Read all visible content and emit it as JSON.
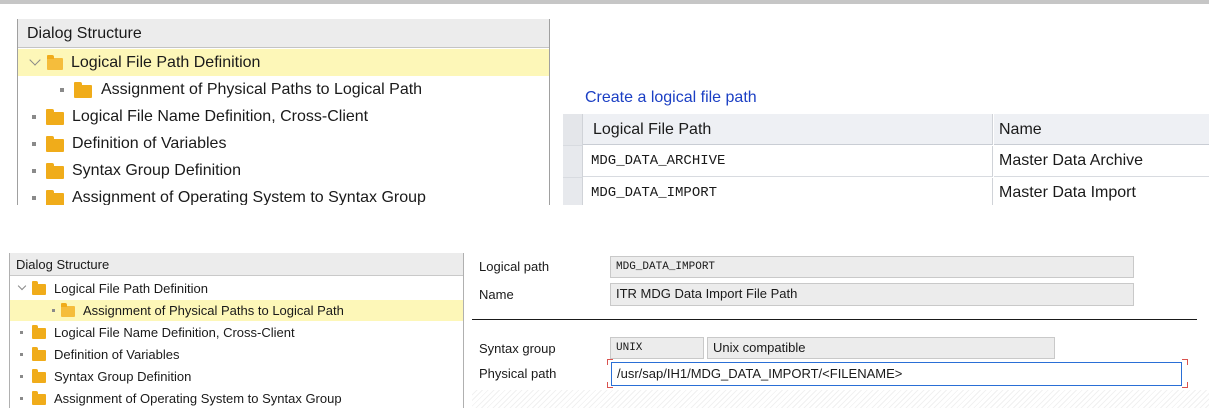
{
  "top": {
    "tree": {
      "header": "Dialog Structure",
      "items": [
        {
          "label": "Logical File Path Definition"
        },
        {
          "label": "Assignment of Physical Paths to Logical Path"
        },
        {
          "label": "Logical File Name Definition, Cross-Client"
        },
        {
          "label": "Definition of Variables"
        },
        {
          "label": "Syntax Group Definition"
        },
        {
          "label": "Assignment of Operating System to Syntax Group"
        }
      ]
    },
    "create_link": "Create a logical file path",
    "table": {
      "columns": [
        "Logical File Path",
        "Name"
      ],
      "rows": [
        {
          "path": "MDG_DATA_ARCHIVE",
          "name": "Master Data Archive"
        },
        {
          "path": "MDG_DATA_IMPORT",
          "name": "Master Data Import"
        }
      ]
    }
  },
  "bottom": {
    "tree": {
      "header": "Dialog Structure",
      "items": [
        {
          "label": "Logical File Path Definition"
        },
        {
          "label": "Assignment of Physical Paths to Logical Path"
        },
        {
          "label": "Logical File Name Definition, Cross-Client"
        },
        {
          "label": "Definition of Variables"
        },
        {
          "label": "Syntax Group Definition"
        },
        {
          "label": "Assignment of Operating System to Syntax Group"
        }
      ]
    },
    "form": {
      "logical_path_label": "Logical path",
      "logical_path_value": "MDG_DATA_IMPORT",
      "name_label": "Name",
      "name_value": "ITR MDG Data Import File Path",
      "syntax_group_label": "Syntax group",
      "syntax_group_value": "UNIX",
      "syntax_group_desc": "Unix compatible",
      "physical_path_label": "Physical path",
      "physical_path_value": "/usr/sap/IH1/MDG_DATA_IMPORT/<FILENAME>"
    }
  },
  "colors": {
    "selection": "#fdf7b8",
    "folder": "#f0ac1a",
    "link": "#1b3fc4",
    "field_focus": "#2a6fd6"
  },
  "icons": [
    "chevron-down-icon",
    "folder-icon",
    "open-folder-icon",
    "bullet-icon"
  ]
}
